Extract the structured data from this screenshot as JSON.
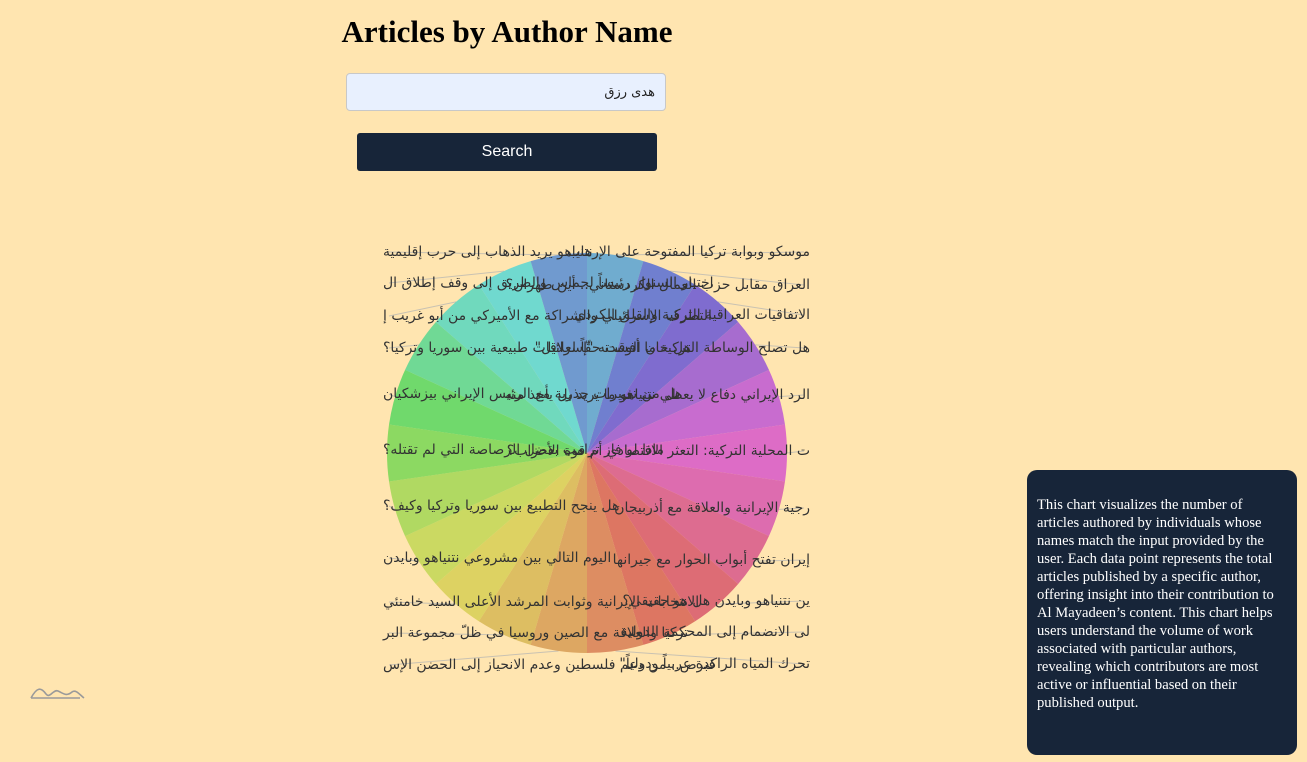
{
  "header": {
    "title": "Articles by Author Name"
  },
  "search": {
    "value": "هدى رزق",
    "button_label": "Search"
  },
  "info_card": {
    "text": "This chart visualizes the number of articles authored by individuals whose names match the input provided by the user. Each data point represents the total articles published by a specific author, offering insight into their contribution to Al Mayadeen’s content. This chart helps users understand the volume of work associated with particular authors, revealing which contributors are most active or influential based on their published output."
  },
  "chart_data": {
    "type": "pie",
    "title": "",
    "categories": [
      "موسكو وبوابة تركيا المفتوحة على الإرهاب",
      "العراق مقابل حزب العمال الكردستاني.. أين طهران؟",
      "الاتفاقيات العراقية التركية والقلق الكردي",
      "هل تصلح الوساطة التركية ما أفسدته \"إسرائيل\"",
      "الرد الإيراني دفاع لا يعطي نتنياهو ما يريد بل يأخذ منه",
      "ت المحلية التركية: التعثر الاقتصادي أم قوة الأحزاب؟",
      "رجية الإيرانية والعلاقة مع أذربيجان",
      "إيران تفتح أبواب الحوار مع جيرانها",
      "ين نتنياهو وبايدن هل هو حقيقي؟",
      "لى الانضمام إلى المحكمة الدولية",
      "تحرك المياه الراكدة عربياً ودولياً\"",
      "قبرص.. من دعم فلسطين وعدم الانحياز إلى الحضن الإس",
      "تركيا والعلاقة مع الصين وروسيا في ظلّ مجموعة البر",
      "الانتخابات الإيرانية وثوابت المرشد الأعلى السيد خامنئي",
      "اليوم التالي بين مشروعي نتنياهو وبايدن",
      "هل ينجح التطبيع بين سوريا وتركيا وكيف؟",
      "ماذا لو فاز ترامب بفضل الرصاصة التي لم تقتله؟",
      "هل من تغييرات جذرية مع الرئيس الإيراني بيزشكيان",
      "هل حان الوقت حقّاً لعلاقات طبيعية بين سوريا وتركيا؟",
      "التطرف الإسرائيلي والشراكة مع الأميركي  من أبو غريب إ",
      "اختيار السنوار رئيساً لحماس والطريق إلى وقف إطلاق ال",
      "نتنياهو يريد الذهاب إلى حرب إقليمية"
    ],
    "values": [
      1,
      1,
      1,
      1,
      1,
      1,
      1,
      1,
      1,
      1,
      1,
      1,
      1,
      1,
      1,
      1,
      1,
      1,
      1,
      1,
      1,
      1
    ],
    "legend": "none"
  }
}
